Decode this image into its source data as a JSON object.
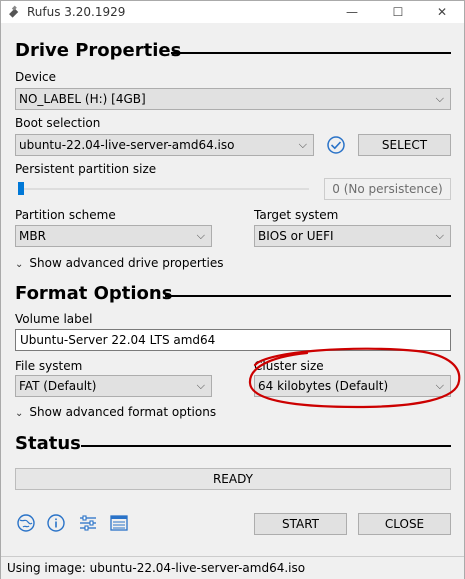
{
  "window": {
    "title": "Rufus 3.20.1929",
    "minimize_glyph": "—",
    "maximize_glyph": "☐",
    "close_glyph": "✕"
  },
  "drive_properties": {
    "heading": "Drive Properties",
    "device_label": "Device",
    "device_value": "NO_LABEL (H:) [4GB]",
    "boot_label": "Boot selection",
    "boot_value": "ubuntu-22.04-live-server-amd64.iso",
    "select_button": "SELECT",
    "persistent_label": "Persistent partition size",
    "persistent_value": "0 (No persistence)",
    "persistent_level": 0,
    "partition_label": "Partition scheme",
    "partition_value": "MBR",
    "target_label": "Target system",
    "target_value": "BIOS or UEFI",
    "advanced_toggle": "Show advanced drive properties"
  },
  "format_options": {
    "heading": "Format Options",
    "volume_label": "Volume label",
    "volume_value": "Ubuntu-Server 22.04 LTS amd64",
    "filesystem_label": "File system",
    "filesystem_value": "FAT (Default)",
    "cluster_label": "Cluster size",
    "cluster_value": "64 kilobytes (Default)",
    "advanced_toggle": "Show advanced format options"
  },
  "status": {
    "heading": "Status",
    "progress_text": "READY",
    "start_button": "START",
    "close_button": "CLOSE"
  },
  "footer": {
    "text": "Using image: ubuntu-22.04-live-server-amd64.iso"
  },
  "icons": {
    "dropdown": "chevron-down-icon",
    "expand": "chevron-down-small-icon",
    "toolbar": [
      "globe-icon",
      "info-icon",
      "settings-sliders-icon",
      "log-icon"
    ]
  },
  "colors": {
    "accent": "#0078d7",
    "annotation": "#cc0000"
  }
}
